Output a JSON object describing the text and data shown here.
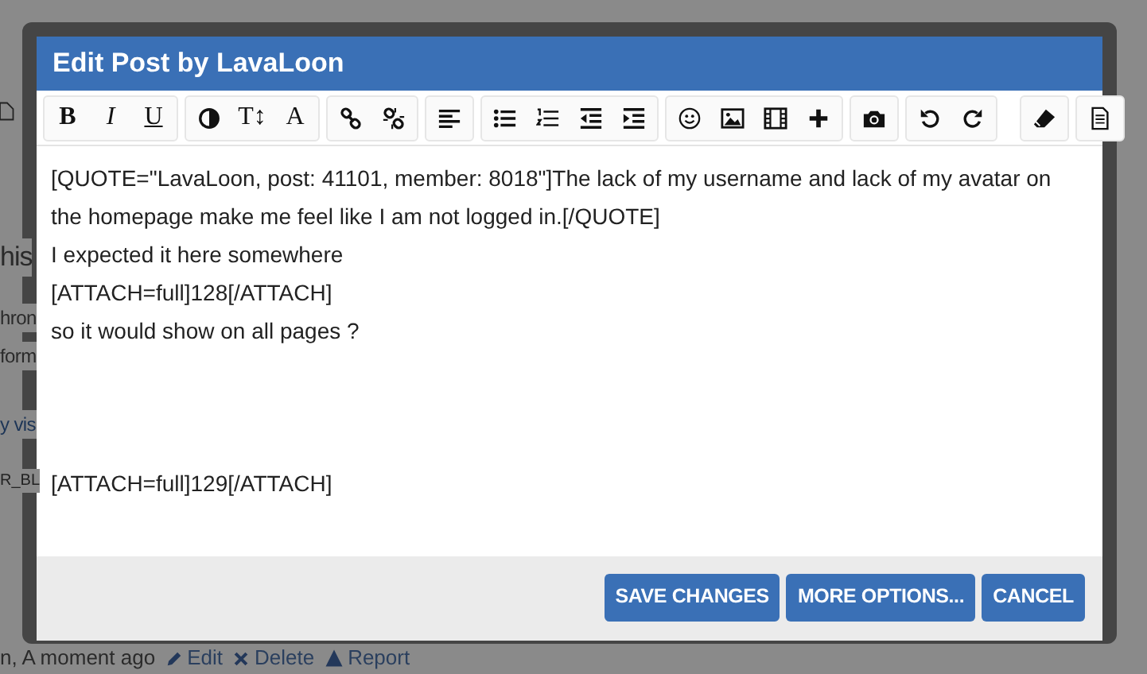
{
  "background_page": {
    "heading": "his",
    "lines": [
      "hron",
      "form"
    ],
    "link": "y vis",
    "code": "R_BL",
    "meta": "n, A moment ago",
    "actions": [
      {
        "label": "Edit"
      },
      {
        "label": "Delete"
      },
      {
        "label": "Report"
      }
    ]
  },
  "dialog": {
    "title": "Edit Post by LavaLoon",
    "toolbar": [
      [
        {
          "kind": "text",
          "text": "B"
        },
        {
          "kind": "text",
          "text": "I"
        },
        {
          "kind": "text",
          "text": "U"
        }
      ],
      [
        {
          "kind": "icon"
        },
        {
          "kind": "text",
          "text": "T↕"
        },
        {
          "kind": "text",
          "text": "A"
        }
      ],
      [
        {
          "kind": "icon"
        },
        {
          "kind": "icon"
        }
      ],
      [
        {
          "kind": "icon"
        }
      ],
      [
        {
          "kind": "icon"
        },
        {
          "kind": "icon"
        },
        {
          "kind": "icon"
        },
        {
          "kind": "icon"
        }
      ],
      [
        {
          "kind": "icon"
        },
        {
          "kind": "icon"
        },
        {
          "kind": "icon"
        },
        {
          "kind": "icon"
        }
      ],
      [
        {
          "kind": "icon"
        }
      ],
      [
        {
          "kind": "icon"
        },
        {
          "kind": "icon"
        }
      ],
      [
        {
          "kind": "icon"
        }
      ],
      [
        {
          "kind": "icon"
        }
      ]
    ],
    "value": "[QUOTE=\"LavaLoon, post: 41101, member: 8018\"]The lack of my username and lack of my avatar on the homepage make me feel like I am not logged in.[/QUOTE]\nI expected it here somewhere\n[ATTACH=full]128[/ATTACH]\nso it would show on all pages ?\n\n\n\n[ATTACH=full]129[/ATTACH]",
    "buttons": [
      "SAVE CHANGES",
      "MORE OPTIONS...",
      "CANCEL"
    ]
  }
}
